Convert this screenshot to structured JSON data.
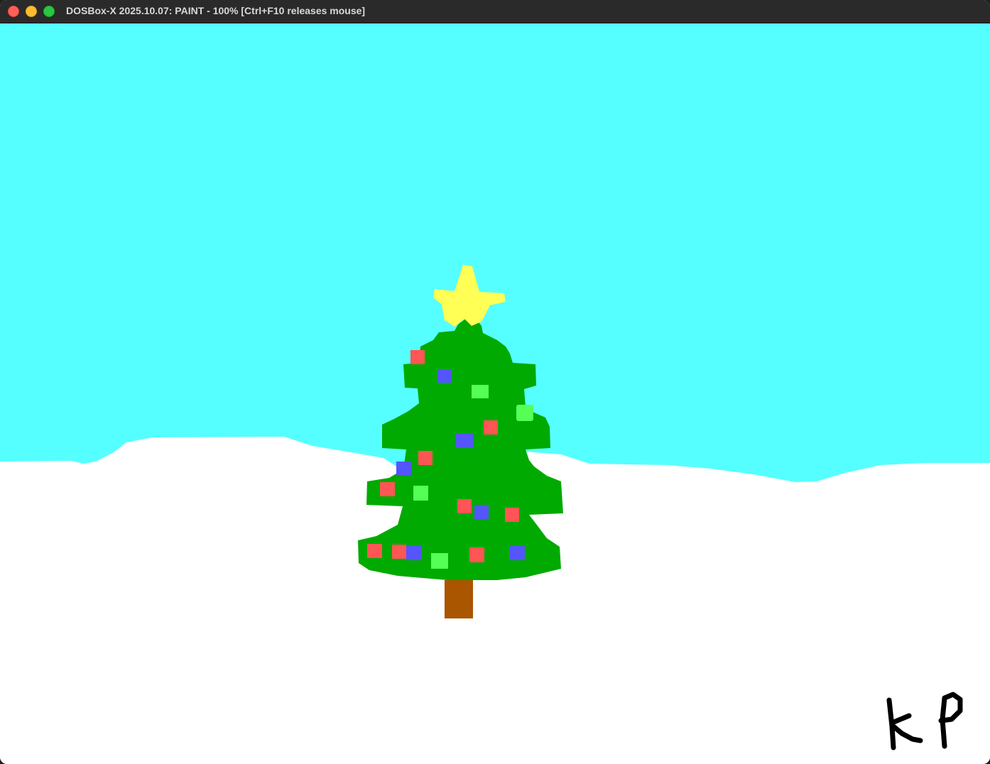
{
  "window": {
    "title": "DOSBox-X 2025.10.07: PAINT - 100% [Ctrl+F10 releases mouse]"
  },
  "painting": {
    "colors": {
      "sky": "#55FFFF",
      "snow": "#FFFFFF",
      "tree": "#00AA00",
      "trunk": "#AA5500",
      "star": "#FFFF55",
      "ornament_red": "#FF5555",
      "ornament_blue": "#5555FF",
      "ornament_green": "#55FF55",
      "signature": "#000000"
    },
    "signature_text": "KP"
  }
}
